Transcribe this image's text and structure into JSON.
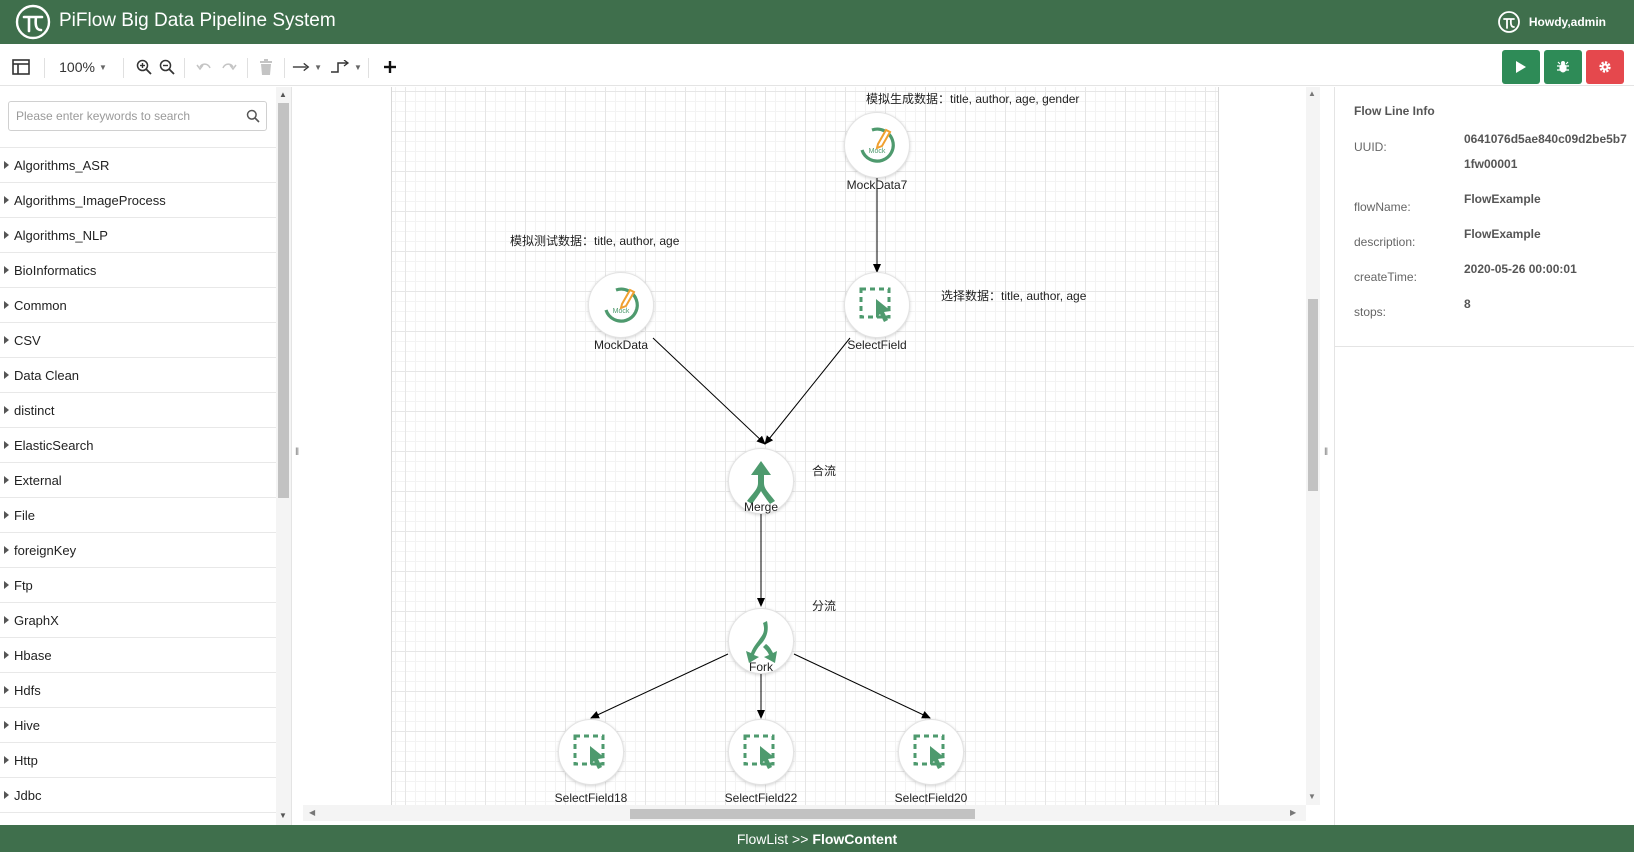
{
  "header": {
    "title": "PiFlow Big Data Pipeline System",
    "user_greeting": "Howdy,admin"
  },
  "toolbar": {
    "zoom": "100%",
    "run_color": "#2e8b57",
    "debug_color": "#2e8b57",
    "stop_color": "#e5484d"
  },
  "sidebar": {
    "search_placeholder": "Please enter keywords to search",
    "categories": [
      "Algorithms_ASR",
      "Algorithms_ImageProcess",
      "Algorithms_NLP",
      "BioInformatics",
      "Common",
      "CSV",
      "Data Clean",
      "distinct",
      "ElasticSearch",
      "External",
      "File",
      "foreignKey",
      "Ftp",
      "GraphX",
      "Hbase",
      "Hdfs",
      "Hive",
      "Http",
      "Jdbc"
    ]
  },
  "canvas": {
    "nodes": {
      "mockdata7": {
        "label": "MockData7",
        "badge": "Mock",
        "note": "模拟生成数据：title, author, age, gender",
        "icon": "mock-icon"
      },
      "mockdata": {
        "label": "MockData",
        "badge": "Mock",
        "note": "模拟测试数据：title, author, age",
        "icon": "mock-icon"
      },
      "selectfield": {
        "label": "SelectField",
        "note": "选择数据：title, author, age",
        "icon": "select-icon"
      },
      "merge": {
        "label": "Merge",
        "note": "合流",
        "icon": "merge-icon"
      },
      "fork": {
        "label": "Fork",
        "note": "分流",
        "icon": "fork-icon"
      },
      "selectfield18": {
        "label": "SelectField18",
        "icon": "select-icon"
      },
      "selectfield22": {
        "label": "SelectField22",
        "icon": "select-icon"
      },
      "selectfield20": {
        "label": "SelectField20",
        "icon": "select-icon"
      }
    },
    "node_color": "#4e9a6e",
    "mock_accent": "#f0a030"
  },
  "info": {
    "title": "Flow Line Info",
    "fields": [
      {
        "key": "UUID:",
        "value": "0641076d5ae840c09d2be5b71fw00001"
      },
      {
        "key": "flowName:",
        "value": "FlowExample"
      },
      {
        "key": "description:",
        "value": "FlowExample"
      },
      {
        "key": "createTime:",
        "value": "2020-05-26 00:00:01"
      },
      {
        "key": "stops:",
        "value": "8"
      }
    ]
  },
  "footer": {
    "path_prefix": "FlowList >>",
    "path_current": "FlowContent"
  }
}
